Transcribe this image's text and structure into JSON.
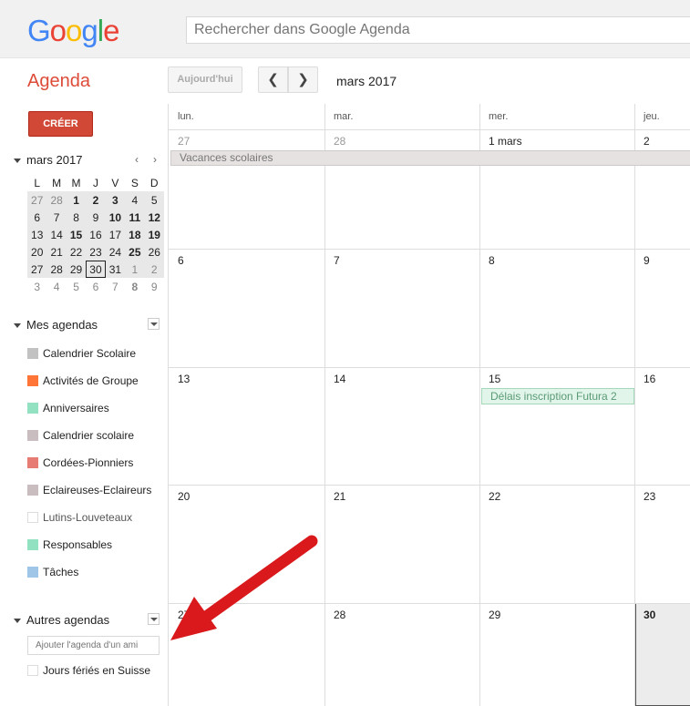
{
  "logo": "Google",
  "search": {
    "placeholder": "Rechercher dans Google Agenda"
  },
  "app_title": "Agenda",
  "toolbar": {
    "today": "Aujourd'hui",
    "prev": "‹",
    "next": "›",
    "current_month": "mars 2017"
  },
  "create_label": "CRÉER",
  "mini_calendar": {
    "title": "mars 2017",
    "prev": "‹",
    "next": "›",
    "weekdays": [
      "L",
      "M",
      "M",
      "J",
      "V",
      "S",
      "D"
    ],
    "weeks": [
      [
        "27",
        "28",
        "1",
        "2",
        "3",
        "4",
        "5"
      ],
      [
        "6",
        "7",
        "8",
        "9",
        "10",
        "11",
        "12"
      ],
      [
        "13",
        "14",
        "15",
        "16",
        "17",
        "18",
        "19"
      ],
      [
        "20",
        "21",
        "22",
        "23",
        "24",
        "25",
        "26"
      ],
      [
        "27",
        "28",
        "29",
        "30",
        "31",
        "1",
        "2"
      ],
      [
        "3",
        "4",
        "5",
        "6",
        "7",
        "8",
        "9"
      ]
    ]
  },
  "my_calendars": {
    "title": "Mes agendas",
    "items": [
      {
        "label": "Calendrier Scolaire",
        "color": "#c2c2c2"
      },
      {
        "label": "Activités de Groupe",
        "color": "#ff7537"
      },
      {
        "label": "Anniversaires",
        "color": "#92e1c0"
      },
      {
        "label": "Calendrier scolaire",
        "color": "#cabdbf"
      },
      {
        "label": "Cordées-Pionniers",
        "color": "#e67c73"
      },
      {
        "label": "Eclaireuses-Eclaireurs",
        "color": "#cabdbf"
      },
      {
        "label": "Lutins-Louveteaux",
        "color": "#ffffff"
      },
      {
        "label": "Responsables",
        "color": "#92e1c0"
      },
      {
        "label": "Tâches",
        "color": "#9fc6e7"
      }
    ]
  },
  "other_calendars": {
    "title": "Autres agendas",
    "add_placeholder": "Ajouter l'agenda d'un ami",
    "items": [
      {
        "label": "Jours fériés en Suisse",
        "color": "#ffffff"
      }
    ]
  },
  "month_grid": {
    "weekdays": [
      "lun.",
      "mar.",
      "mer.",
      "jeu."
    ],
    "weeks": [
      [
        "27",
        "28",
        "1 mars",
        "2"
      ],
      [
        "6",
        "7",
        "8",
        "9"
      ],
      [
        "13",
        "14",
        "15",
        "16"
      ],
      [
        "20",
        "21",
        "22",
        "23"
      ],
      [
        "27",
        "28",
        "29",
        "30"
      ]
    ],
    "events": {
      "vacances": "Vacances scolaires",
      "futura": "Délais inscription Futura 2"
    }
  }
}
